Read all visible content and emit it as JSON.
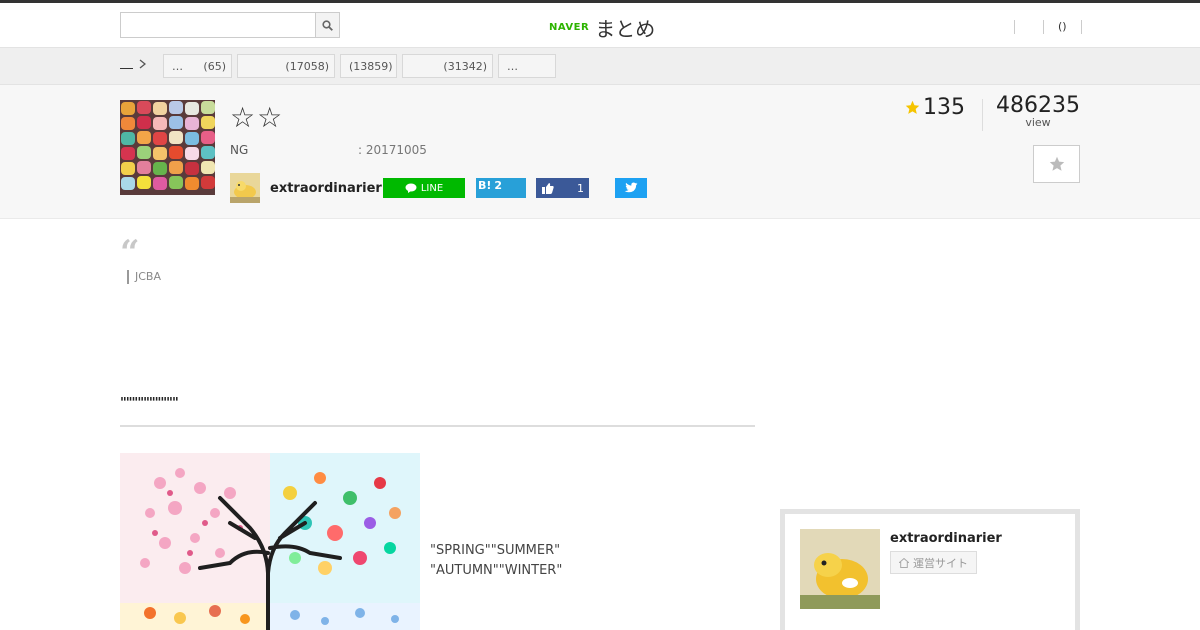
{
  "header": {
    "search": {
      "placeholder": "",
      "value": ""
    },
    "logo": {
      "naver": "NAVER",
      "matome": "まとめ"
    },
    "right_links": [
      "",
      "()",
      ""
    ]
  },
  "categories": {
    "home_label": "",
    "tabs": [
      {
        "label": "…",
        "count": "(65)"
      },
      {
        "label": "",
        "count": "(17058)"
      },
      {
        "label": "",
        "count": "(13859)"
      },
      {
        "label": "",
        "count": "(31342)"
      },
      {
        "label": "…",
        "count": ""
      }
    ]
  },
  "matome": {
    "title": "☆☆",
    "ng_label": "NG",
    "date_text": ": 20171005",
    "author": "extraordinarier",
    "share": {
      "line": "LINE",
      "hatena_mark": "B!",
      "hatena_count": "2",
      "facebook_count": "1"
    },
    "favorites": "135",
    "views": "486235",
    "views_label": "view"
  },
  "content": {
    "quote_mark": "“",
    "quote_source": "JCBA",
    "section_heading": "\"\"\"\"\"\"\"\"\"\"",
    "caption_line1": "\"SPRING\"\"SUMMER\"",
    "caption_line2": "\"AUTUMN\"\"WINTER\""
  },
  "sidebar": {
    "author_name": "extraordinarier",
    "site_label": "運営サイト"
  },
  "colors": {
    "line": "#00b900",
    "hatena": "#28a0d8",
    "facebook": "#3b5998",
    "twitter": "#1da1f2",
    "naver": "#2db400",
    "star": "#f5c400"
  },
  "icons": [
    "search-icon",
    "chevron-right-icon",
    "line-icon",
    "facebook-like-icon",
    "twitter-bird-icon",
    "star-icon",
    "home-icon",
    "quote-icon"
  ]
}
